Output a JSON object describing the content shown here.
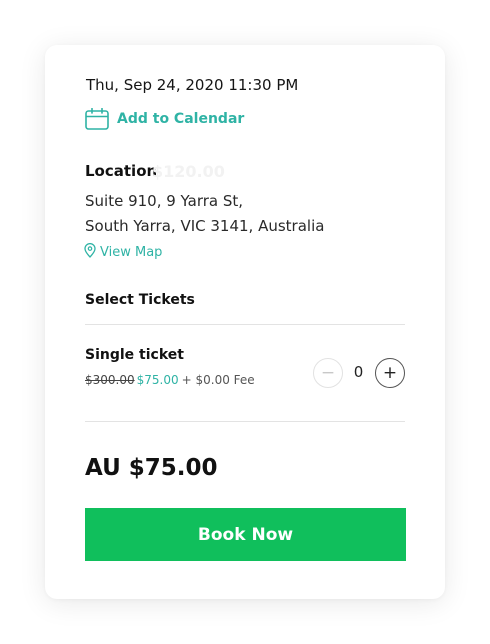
{
  "event": {
    "datetime": "Thu, Sep 24, 2020 11:30 PM",
    "add_to_calendar_label": "Add to Calendar"
  },
  "location": {
    "label": "Location",
    "ghost_price": "$120.00",
    "address_line1": "Suite 910, 9 Yarra St,",
    "address_line2": "South Yarra, VIC 3141, Australia",
    "view_map_label": "View Map"
  },
  "tickets": {
    "heading": "Select Tickets",
    "items": [
      {
        "name": "Single ticket",
        "original_price": "$300.00",
        "sale_price": "$75.00",
        "fee": "+ $0.00 Fee",
        "quantity": "0",
        "minus_symbol": "−",
        "plus_symbol": "+"
      }
    ]
  },
  "summary": {
    "total": "AU $75.00",
    "book_button_label": "Book Now"
  },
  "icons": {
    "calendar": "calendar-icon",
    "map_pin": "map-pin-icon"
  },
  "colors": {
    "accent": "#2fb3a5",
    "book_button": "#10bf5c",
    "divider": "#e3e3e3"
  }
}
